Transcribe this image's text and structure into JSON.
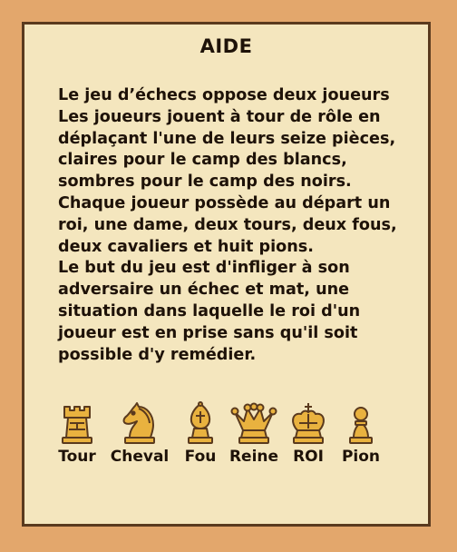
{
  "help": {
    "title": "AIDE",
    "paragraph1": "Le jeu d’échecs oppose deux joueurs Les joueurs jouent à tour de rôle en déplaçant l'une de leurs seize pièces, claires pour le camp des blancs, sombres pour le camp des noirs. Chaque joueur possède au départ un roi, une dame, deux tours, deux fous, deux cavaliers et huit pions.",
    "paragraph2": "Le but du jeu est d'infliger à son adversaire un échec et mat, une situation dans laquelle le roi d'un joueur est en prise sans qu'il soit possible d'y remédier."
  },
  "pieces": [
    {
      "icon": "rook-icon",
      "label": "Tour"
    },
    {
      "icon": "knight-icon",
      "label": "Cheval"
    },
    {
      "icon": "bishop-icon",
      "label": "Fou"
    },
    {
      "icon": "queen-icon",
      "label": "Reine"
    },
    {
      "icon": "king-icon",
      "label": "ROI"
    },
    {
      "icon": "pawn-icon",
      "label": "Pion"
    }
  ],
  "colors": {
    "background": "#E3A76C",
    "panel": "#F4E6BE",
    "border": "#5A3A1E",
    "text": "#1E1208",
    "piece_fill": "#E9B23F",
    "piece_outline": "#5A3A1E"
  }
}
